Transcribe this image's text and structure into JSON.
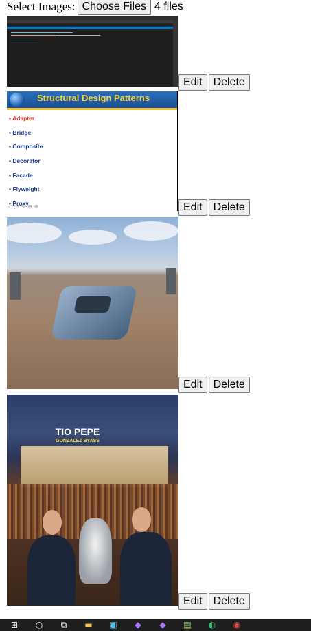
{
  "form": {
    "label": "Select Images:",
    "choose_button": "Choose Files",
    "file_count": "4 files"
  },
  "images": [
    {
      "edit_label": "Edit",
      "delete_label": "Delete"
    },
    {
      "slide_title": "Structural Design Patterns",
      "bullets": [
        "Adapter",
        "Bridge",
        "Composite",
        "Decorator",
        "Facade",
        "Flyweight",
        "Proxy"
      ],
      "edit_label": "Edit",
      "delete_label": "Delete"
    },
    {
      "edit_label": "Edit",
      "delete_label": "Delete"
    },
    {
      "sign_text": "TIO PEPE",
      "sign_subtext": "GONZALEZ BYASS",
      "edit_label": "Edit",
      "delete_label": "Delete"
    }
  ],
  "taskbar": {
    "icons": [
      "windows-start-icon",
      "search-icon",
      "task-view-icon",
      "file-explorer-icon",
      "store-icon",
      "visual-studio-icon",
      "visual-studio-preview-icon",
      "notepad-icon",
      "edge-icon",
      "chrome-icon"
    ]
  }
}
